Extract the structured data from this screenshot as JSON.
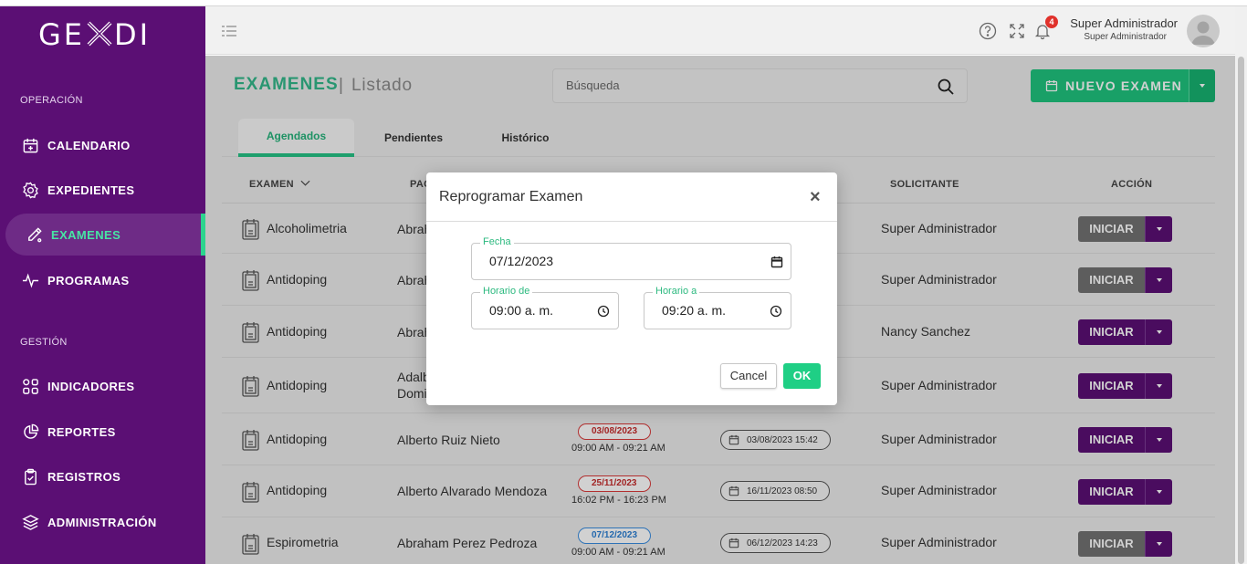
{
  "app": {
    "logo": "GE DI"
  },
  "sidebar": {
    "sections": [
      {
        "label": "OPERACIÓN"
      },
      {
        "label": "GESTIÓN"
      }
    ],
    "items": [
      {
        "label": "CALENDARIO",
        "icon": "calendar-plus-icon"
      },
      {
        "label": "EXPEDIENTES",
        "icon": "gear-icon"
      },
      {
        "label": "EXAMENES",
        "icon": "pipette-icon",
        "active": true
      },
      {
        "label": "PROGRAMAS",
        "icon": "pulse-icon"
      },
      {
        "label": "INDICADORES",
        "icon": "grid-icon"
      },
      {
        "label": "REPORTES",
        "icon": "pie-chart-icon"
      },
      {
        "label": "REGISTROS",
        "icon": "clipboard-icon"
      },
      {
        "label": "ADMINISTRACIÓN",
        "icon": "layers-icon"
      }
    ]
  },
  "header": {
    "notifications": "4",
    "user_name": "Super Administrador",
    "user_role": "Super Administrador"
  },
  "page": {
    "title": "EXAMENES",
    "separator": "|",
    "subtitle": "Listado",
    "search_placeholder": "Búsqueda",
    "new_button": "NUEVO EXAMEN"
  },
  "tabs": [
    {
      "label": "Agendados",
      "active": true
    },
    {
      "label": "Pendientes"
    },
    {
      "label": "Histórico"
    }
  ],
  "table": {
    "headers": {
      "exam": "EXAMEN",
      "patient": "PAC",
      "requester": "SOLICITANTE",
      "action": "ACCIÓN"
    },
    "rows": [
      {
        "exam": "Alcoholimetria",
        "patient": "Abrah",
        "requester": "Super Administrador",
        "action": "INICIAR",
        "action_state": "gray"
      },
      {
        "exam": "Antidoping",
        "patient": "Abrah",
        "requester": "Super Administrador",
        "action": "INICIAR",
        "action_state": "gray"
      },
      {
        "exam": "Antidoping",
        "patient": "Abrah",
        "requester": "Nancy Sanchez",
        "action": "INICIAR",
        "action_state": "purple"
      },
      {
        "exam": "Antidoping",
        "patient": "Adalb",
        "patient2": "Domi",
        "requester": "Super Administrador",
        "action": "INICIAR",
        "action_state": "purple"
      },
      {
        "exam": "Antidoping",
        "patient": "Alberto Ruiz Nieto",
        "date": "03/08/2023",
        "date_color": "red",
        "time": "09:00 AM - 09:21 AM",
        "created": "03/08/2023 15:42",
        "requester": "Super Administrador",
        "action": "INICIAR",
        "action_state": "purple"
      },
      {
        "exam": "Antidoping",
        "patient": "Alberto Alvarado Mendoza",
        "date": "25/11/2023",
        "date_color": "red",
        "time": "16:02 PM - 16:23 PM",
        "created": "16/11/2023 08:50",
        "requester": "Super Administrador",
        "action": "INICIAR",
        "action_state": "purple"
      },
      {
        "exam": "Espirometria",
        "patient": "Abraham Perez Pedroza",
        "date": "07/12/2023",
        "date_color": "blue",
        "time": "09:00 AM - 09:21 AM",
        "created": "06/12/2023 14:23",
        "requester": "Super Administrador",
        "action": "INICIAR",
        "action_state": "gray"
      }
    ]
  },
  "modal": {
    "title": "Reprogramar Examen",
    "close": "×",
    "fecha_label": "Fecha",
    "fecha_value": "07/12/2023",
    "desde_label": "Horario de",
    "desde_value": "09:00 a. m.",
    "hasta_label": "Horario a",
    "hasta_value": "09:20 a. m.",
    "cancel": "Cancel",
    "ok": "OK"
  },
  "colors": {
    "sidebar": "#5b0f74",
    "accent_green": "#1fc47e",
    "action_purple": "#5b0f74",
    "action_gray": "#727272"
  }
}
